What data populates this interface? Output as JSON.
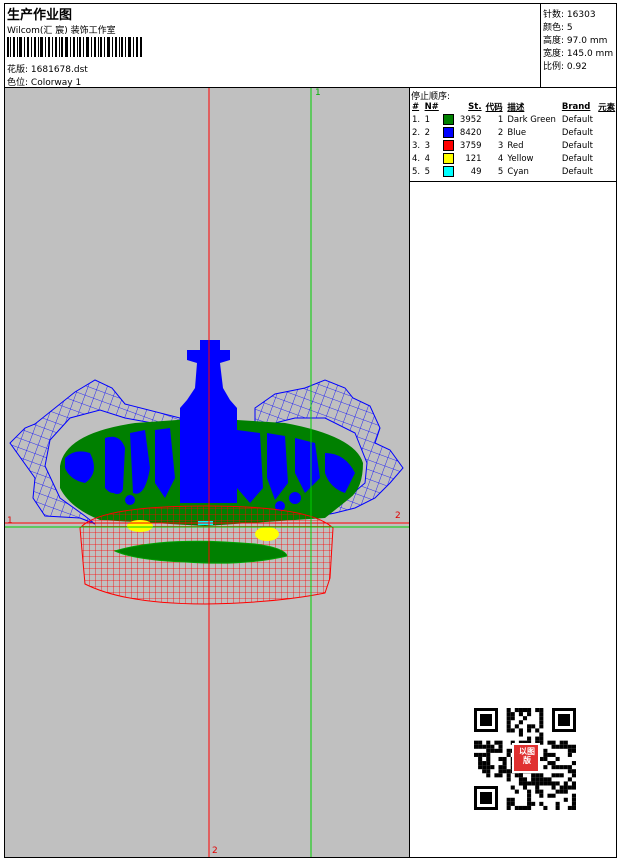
{
  "header": {
    "title": "生产作业图",
    "studio": "Wilcom(汇 宸) 装饰工作室",
    "design_label": "花版:",
    "design_value": "1681678.dst",
    "colorway_label": "色位:",
    "colorway_value": "Colorway 1"
  },
  "stats": [
    {
      "label": "针数:",
      "value": "16303"
    },
    {
      "label": "颜色:",
      "value": "5"
    },
    {
      "label": "高度:",
      "value": "97.0 mm"
    },
    {
      "label": "宽度:",
      "value": "145.0 mm"
    },
    {
      "label": "比例:",
      "value": "0.92"
    }
  ],
  "canvas": {
    "background": "#c0c0c0",
    "axis_labels": {
      "top_green": "1",
      "right_red": "2",
      "left_red": "1",
      "bottom_red": "2"
    }
  },
  "stop_sequence": {
    "title": "停止顺序:",
    "columns": [
      "#",
      "N#",
      "St.",
      "代码",
      "描述",
      "Brand",
      "元素"
    ],
    "rows": [
      {
        "idx": "1.",
        "n": "1",
        "color": "#008000",
        "st": "3952",
        "code": "1",
        "desc": "Dark Green",
        "brand": "Default"
      },
      {
        "idx": "2.",
        "n": "2",
        "color": "#0000ff",
        "st": "8420",
        "code": "2",
        "desc": "Blue",
        "brand": "Default"
      },
      {
        "idx": "3.",
        "n": "3",
        "color": "#ff0000",
        "st": "3759",
        "code": "3",
        "desc": "Red",
        "brand": "Default"
      },
      {
        "idx": "4.",
        "n": "4",
        "color": "#ffff00",
        "st": "121",
        "code": "4",
        "desc": "Yellow",
        "brand": "Default"
      },
      {
        "idx": "5.",
        "n": "5",
        "color": "#00ffff",
        "st": "49",
        "code": "5",
        "desc": "Cyan",
        "brand": "Default"
      }
    ]
  },
  "qr": {
    "stamp_text": "以图版"
  }
}
